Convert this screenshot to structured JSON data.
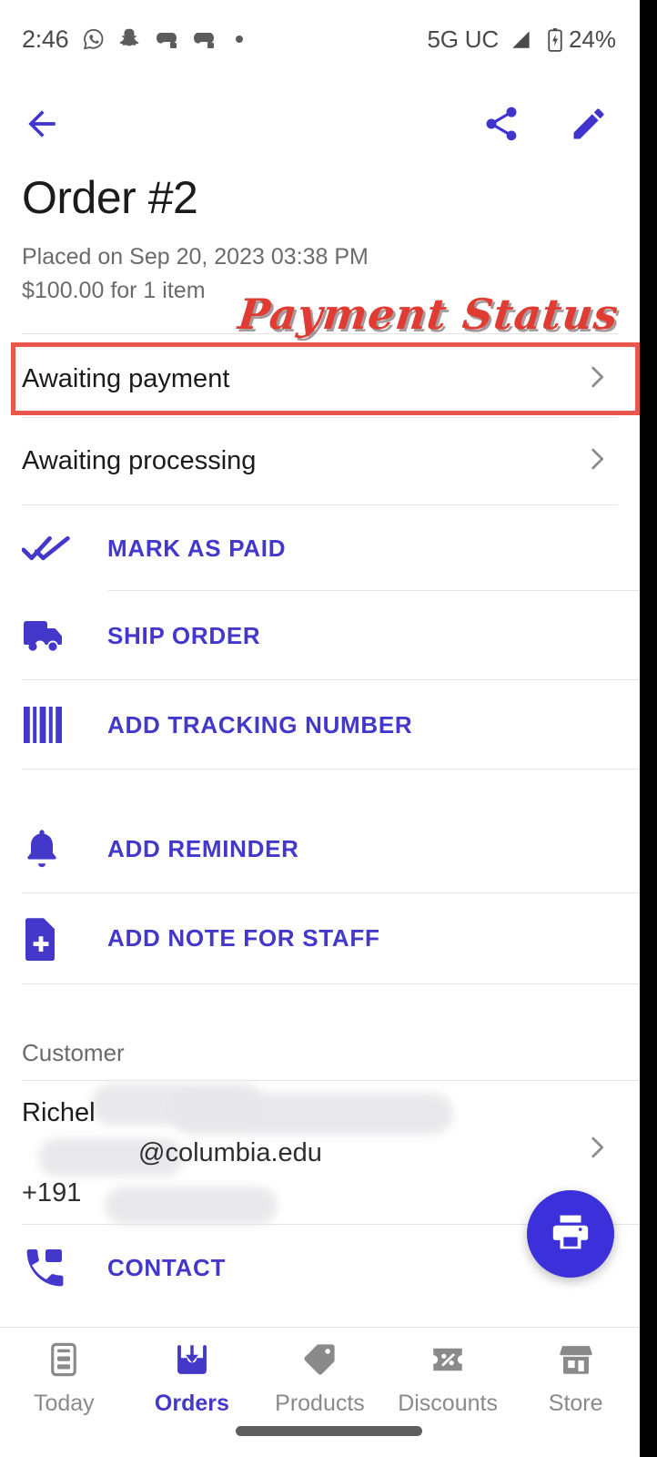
{
  "theme": {
    "accent": "#4338ca",
    "fab_bg": "#3b30d9",
    "annotation_red": "#e03c33",
    "divider": "#e4e4e4"
  },
  "status_bar": {
    "time": "2:46",
    "icons": [
      "whatsapp-icon",
      "snapchat-icon",
      "game-controller-icon",
      "game-controller-icon",
      "dot-icon"
    ],
    "network": "5G UC",
    "battery_percent": "24%",
    "battery_state": "charging"
  },
  "app_bar": {
    "back_label": "Back",
    "share_label": "Share",
    "edit_label": "Edit"
  },
  "order": {
    "title": "Order #2",
    "placed_on": "Placed on Sep 20, 2023 03:38 PM",
    "amount_line": "$100.00 for 1 item"
  },
  "status_rows": [
    {
      "label": "Awaiting payment",
      "highlighted": true
    },
    {
      "label": "Awaiting processing",
      "highlighted": false
    }
  ],
  "actions": [
    {
      "label": "MARK AS PAID",
      "icon": "done-all-icon"
    },
    {
      "label": "SHIP ORDER",
      "icon": "truck-icon"
    },
    {
      "label": "ADD TRACKING NUMBER",
      "icon": "barcode-icon"
    },
    {
      "label": "ADD REMINDER",
      "icon": "bell-icon"
    },
    {
      "label": "ADD NOTE FOR STAFF",
      "icon": "note-add-icon"
    }
  ],
  "customer": {
    "section_label": "Customer",
    "name": "Richel",
    "email": "@columbia.edu",
    "phone": "+191",
    "contact_label": "CONTACT"
  },
  "fab": {
    "icon": "printer-icon",
    "label": "Print"
  },
  "bottom_nav": [
    {
      "label": "Today",
      "icon": "today-card-icon",
      "active": false
    },
    {
      "label": "Orders",
      "icon": "orders-inbox-icon",
      "active": true
    },
    {
      "label": "Products",
      "icon": "tag-icon",
      "active": false
    },
    {
      "label": "Discounts",
      "icon": "percent-ticket-icon",
      "active": false
    },
    {
      "label": "Store",
      "icon": "storefront-icon",
      "active": false
    }
  ],
  "annotations": [
    {
      "text": "Payment Status",
      "type": "handwritten-label"
    },
    {
      "text": "",
      "type": "highlight-box",
      "target": "Awaiting payment"
    }
  ]
}
